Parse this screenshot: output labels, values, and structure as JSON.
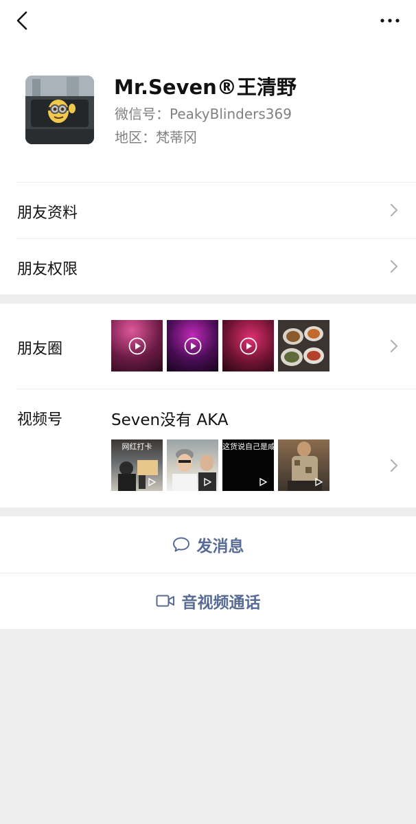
{
  "profile": {
    "name": "Mr.Seven®王清野",
    "wechat_id": "微信号：PeakyBlinders369",
    "region": "地区：梵蒂冈"
  },
  "rows": {
    "friend_info": "朋友资料",
    "friend_permissions": "朋友权限",
    "moments": "朋友圈",
    "channels": "视频号"
  },
  "channels": {
    "name": "Seven没有 AKA",
    "thumb_captions": [
      "网红打卡",
      "",
      "这货说自己是咸鱼",
      ""
    ]
  },
  "actions": {
    "message": "发消息",
    "call": "音视频通话"
  },
  "icons": {
    "back": "chevron-left-icon",
    "more": "more-dots-icon",
    "chevron": "chevron-right-icon",
    "message": "chat-bubble-icon",
    "call": "video-camera-icon",
    "play": "play-icon"
  },
  "colors": {
    "link_blue": "#576b95",
    "background": "#ededed"
  }
}
